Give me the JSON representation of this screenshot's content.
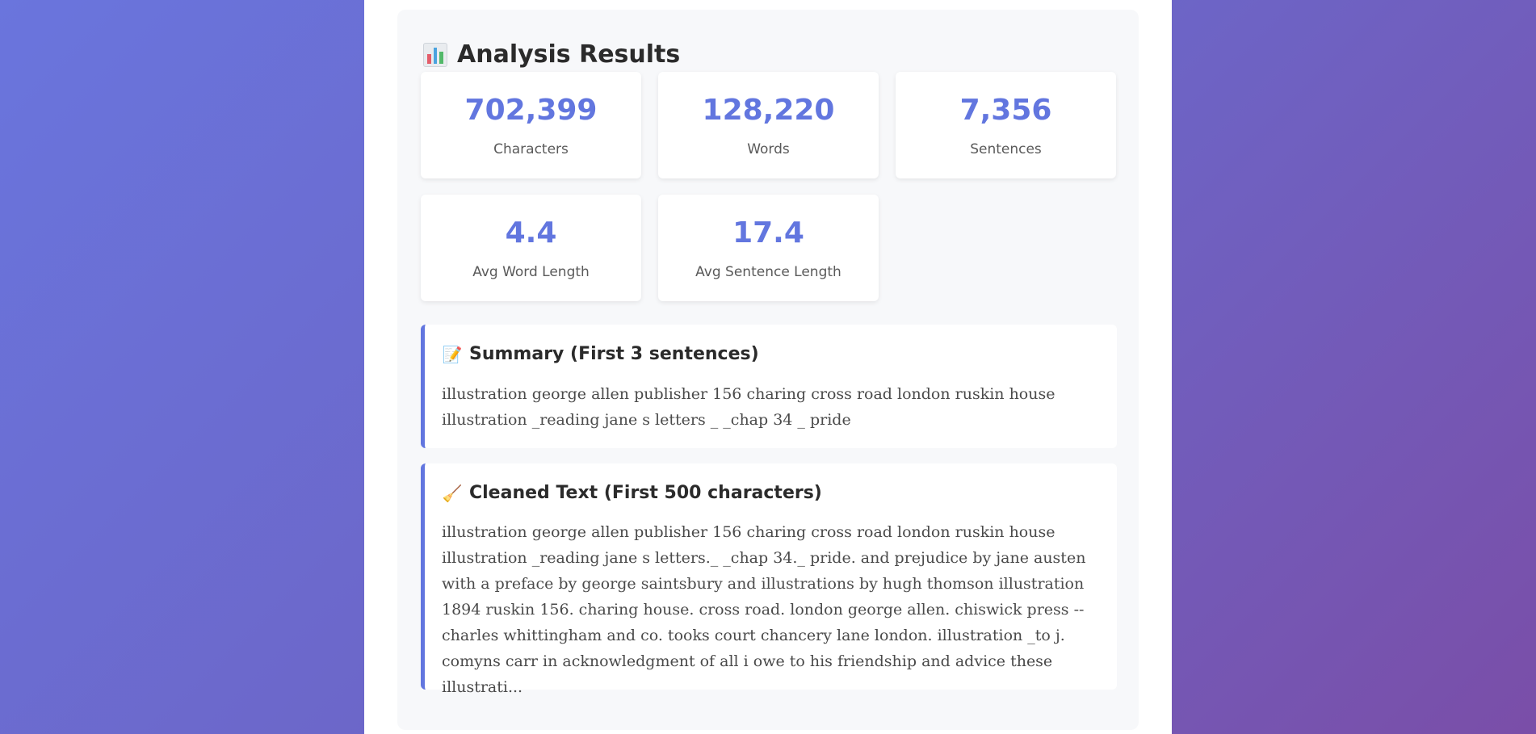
{
  "results": {
    "title": "Analysis Results",
    "title_icon": "bar-chart-icon"
  },
  "stats": [
    {
      "value": "702,399",
      "label": "Characters"
    },
    {
      "value": "128,220",
      "label": "Words"
    },
    {
      "value": "7,356",
      "label": "Sentences"
    },
    {
      "value": "4.4",
      "label": "Avg Word Length"
    },
    {
      "value": "17.4",
      "label": "Avg Sentence Length"
    }
  ],
  "summary": {
    "icon": "memo-icon",
    "heading": "Summary (First 3 sentences)",
    "text": "illustration george allen publisher 156 charing cross road london ruskin house illustration _reading jane s letters _ _chap 34 _ pride"
  },
  "cleaned": {
    "icon": "broom-icon",
    "heading": "Cleaned Text (First 500 characters)",
    "text": "illustration george allen publisher 156 charing cross road london ruskin house illustration _reading jane s letters._ _chap 34._ pride. and prejudice by jane austen with a preface by george saintsbury and illustrations by hugh thomson illustration 1894 ruskin 156. charing house. cross road. london george allen. chiswick press --charles whittingham and co. tooks court chancery lane london. illustration _to j. comyns carr in acknowledgment of all i owe to his friendship and advice these illustrati..."
  },
  "colors": {
    "accent": "#6276df",
    "background_start": "#6a75dd",
    "background_end": "#7a4ea8"
  }
}
